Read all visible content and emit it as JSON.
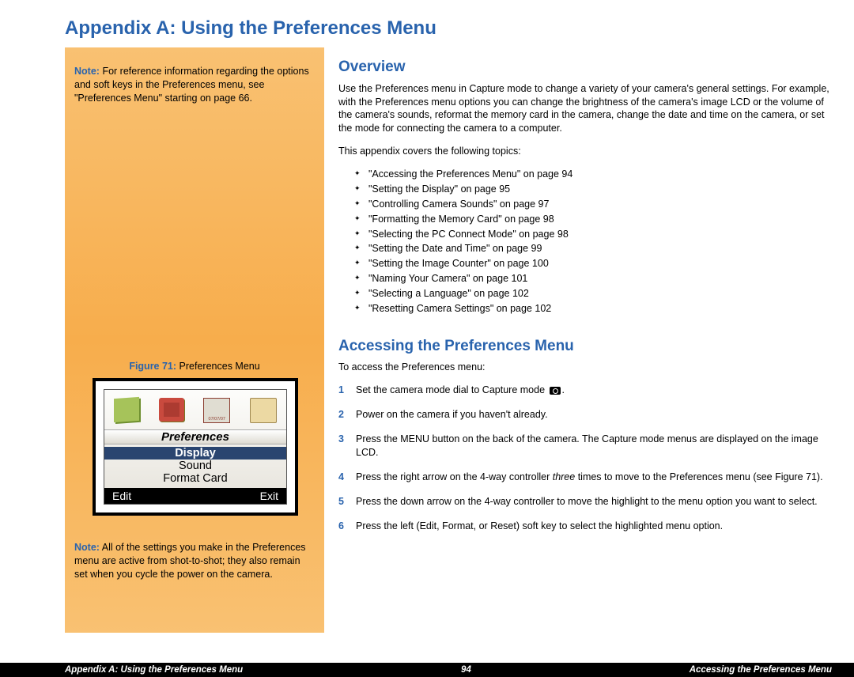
{
  "colors": {
    "accent": "#2963ad"
  },
  "page": {
    "title": "Appendix A: Using the Preferences Menu"
  },
  "sidebar": {
    "note1": {
      "label": "Note:",
      "text": "For reference information regarding the options and soft keys in the Preferences menu, see \"Preferences Menu\" starting on page 66."
    },
    "figure": {
      "label": "Figure 71:",
      "caption": "Preferences Menu",
      "menu_title": "Preferences",
      "items": [
        "Display",
        "Sound",
        "Format Card"
      ],
      "selected_index": 0,
      "soft_left": "Edit",
      "soft_right": "Exit",
      "icons": [
        "notes-icon",
        "apps-icon",
        "date-stamp-icon",
        "folder-icon"
      ]
    },
    "note2": {
      "label": "Note:",
      "text": "All of the settings you make in the Preferences menu are active from shot-to-shot; they also remain set when you cycle the power on the camera."
    }
  },
  "overview": {
    "heading": "Overview",
    "p1": "Use the Preferences menu in Capture mode to change a variety of your camera's general settings. For example, with the Preferences menu options you can change the brightness of the camera's image LCD or the volume of the camera's sounds, reformat the memory card in the camera, change the date and time on the camera, or set the mode for connecting the camera to a computer.",
    "p2": "This appendix covers the following topics:",
    "topics": [
      "\"Accessing the Preferences Menu\" on page 94",
      "\"Setting the Display\" on page 95",
      "\"Controlling Camera Sounds\" on page 97",
      "\"Formatting the Memory Card\" on page 98",
      "\"Selecting the PC Connect Mode\" on page 98",
      "\"Setting the Date and Time\" on page 99",
      "\"Setting the Image Counter\" on page 100",
      "\"Naming Your Camera\" on page 101",
      "\"Selecting a Language\" on page 102",
      "\"Resetting Camera Settings\" on page 102"
    ]
  },
  "accessing": {
    "heading": "Accessing the Preferences Menu",
    "intro": "To access the Preferences menu:",
    "steps": [
      {
        "pre": "Set the camera mode dial to Capture mode ",
        "icon": "camera-icon",
        "post": "."
      },
      {
        "pre": "Power on the camera if you haven't already."
      },
      {
        "pre": "Press the MENU button on the back of the camera. The Capture mode menus are displayed on the image LCD."
      },
      {
        "pre": "Press the right arrow on the 4-way controller ",
        "italic": "three",
        "post": "  times to move to the Preferences menu (see Figure 71)."
      },
      {
        "pre": "Press the down arrow on the 4-way controller to move the highlight to the menu option you want to select."
      },
      {
        "pre": "Press the left (Edit, Format, or Reset) soft key to select the highlighted menu option."
      }
    ]
  },
  "footer": {
    "left": "Appendix A: Using the Preferences Menu",
    "center": "94",
    "right": "Accessing the Preferences Menu"
  }
}
